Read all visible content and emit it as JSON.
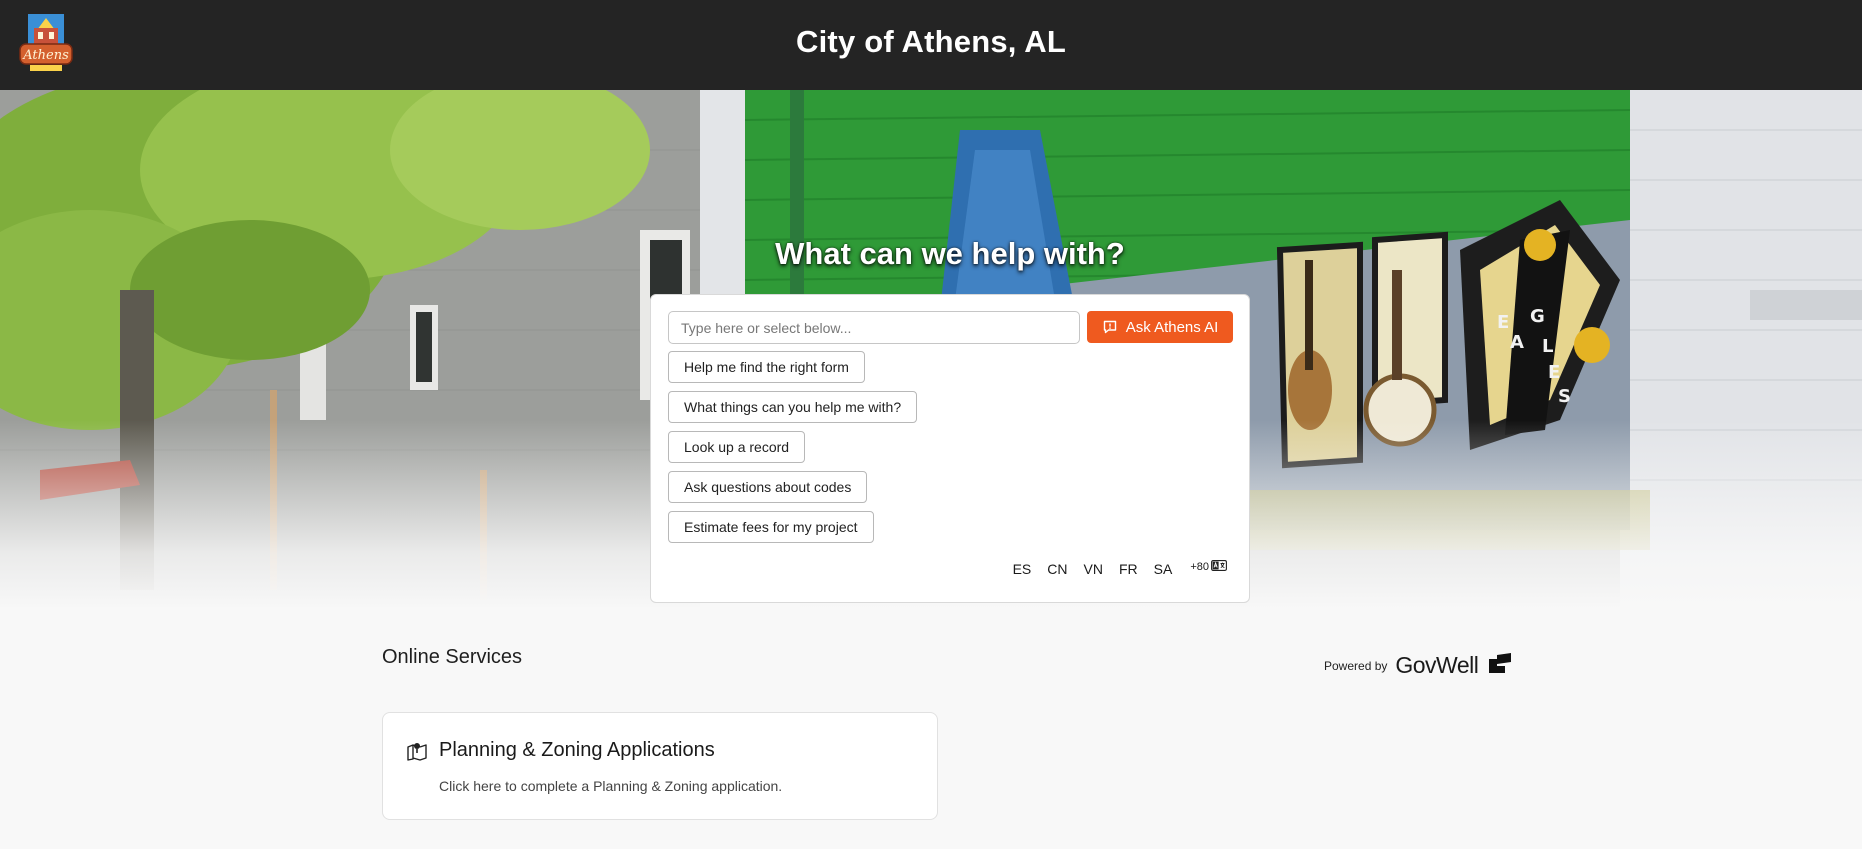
{
  "header": {
    "title": "City of Athens, AL",
    "logo_text": "Athens"
  },
  "hero": {
    "heading": "What can we help with?",
    "mural_letters": [
      "E",
      "A",
      "G",
      "L",
      "E",
      "S"
    ]
  },
  "assistant": {
    "input_placeholder": "Type here or select below...",
    "ask_button_label": "Ask Athens AI",
    "suggestions": [
      "Help me find the right form",
      "What things can you help me with?",
      "Look up a record",
      "Ask questions about codes",
      "Estimate fees for my project"
    ],
    "languages": [
      "ES",
      "CN",
      "VN",
      "FR",
      "SA"
    ],
    "more_languages": "+80"
  },
  "services": {
    "section_title": "Online Services",
    "cards": [
      {
        "title": "Planning & Zoning Applications",
        "description": "Click here to complete a Planning & Zoning application.",
        "icon": "map-pin-icon"
      }
    ]
  },
  "powered_by": {
    "label": "Powered by",
    "brand": "GovWell"
  },
  "colors": {
    "header_bg": "#242424",
    "accent": "#ef5a1f",
    "page_bg": "#f8f8f8"
  }
}
